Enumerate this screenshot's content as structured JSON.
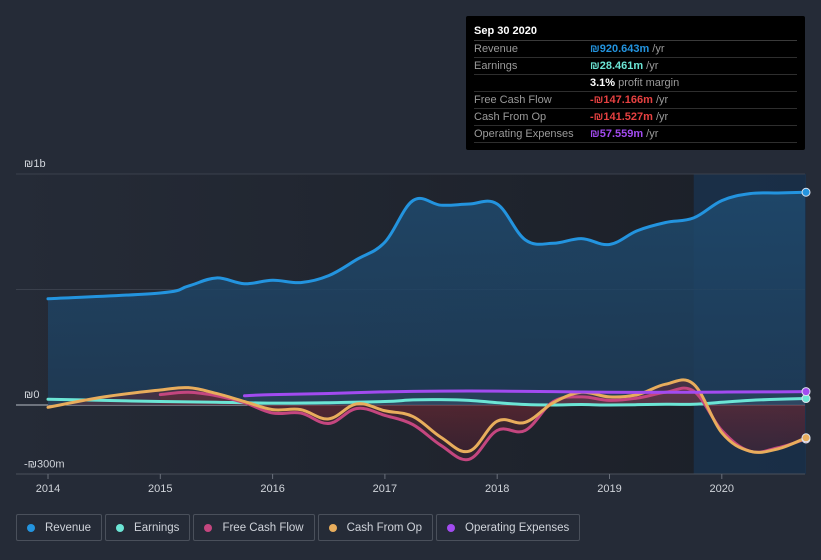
{
  "tooltip": {
    "date": "Sep 30 2020",
    "rows": [
      {
        "label": "Revenue",
        "value": "₪920.643m",
        "unit": "/yr",
        "color": "#2394df"
      },
      {
        "label": "Earnings",
        "value": "₪28.461m",
        "unit": "/yr",
        "color": "#6ce5d5"
      },
      {
        "label": "",
        "value": "3.1%",
        "unit": "profit margin",
        "color": "#ffffff"
      },
      {
        "label": "Free Cash Flow",
        "value": "-₪147.166m",
        "unit": "/yr",
        "color": "#e64141"
      },
      {
        "label": "Cash From Op",
        "value": "-₪141.527m",
        "unit": "/yr",
        "color": "#e64141"
      },
      {
        "label": "Operating Expenses",
        "value": "₪57.559m",
        "unit": "/yr",
        "color": "#a24bf0"
      }
    ]
  },
  "legend": [
    {
      "label": "Revenue",
      "color": "#2394df"
    },
    {
      "label": "Earnings",
      "color": "#6ce5d5"
    },
    {
      "label": "Free Cash Flow",
      "color": "#c4467f"
    },
    {
      "label": "Cash From Op",
      "color": "#e8ad5c"
    },
    {
      "label": "Operating Expenses",
      "color": "#a24bf0"
    }
  ],
  "chart_data": {
    "type": "line",
    "title": "",
    "xlabel": "",
    "ylabel": "",
    "currency": "₪",
    "unit": "m",
    "ylim": [
      -300,
      1000
    ],
    "xlim": [
      2013.7,
      2020.9
    ],
    "y_ticks": [
      {
        "value": 1000,
        "label": "₪1b"
      },
      {
        "value": 0,
        "label": "₪0"
      },
      {
        "value": -300,
        "label": "-₪300m"
      }
    ],
    "x_ticks": [
      {
        "value": 2014,
        "label": "2014"
      },
      {
        "value": 2015,
        "label": "2015"
      },
      {
        "value": 2016,
        "label": "2016"
      },
      {
        "value": 2017,
        "label": "2017"
      },
      {
        "value": 2018,
        "label": "2018"
      },
      {
        "value": 2019,
        "label": "2019"
      },
      {
        "value": 2020,
        "label": "2020"
      }
    ],
    "grid": true,
    "highlight_start": 2019.75,
    "highlight_end": 2020.75,
    "series": [
      {
        "name": "Revenue",
        "color": "#2394df",
        "x": [
          2014.0,
          2015.0,
          2015.25,
          2015.5,
          2015.75,
          2016.0,
          2016.25,
          2016.5,
          2016.75,
          2017.0,
          2017.25,
          2017.5,
          2017.75,
          2018.0,
          2018.25,
          2018.5,
          2018.75,
          2019.0,
          2019.25,
          2019.5,
          2019.75,
          2020.0,
          2020.25,
          2020.5,
          2020.75
        ],
        "values": [
          460,
          485,
          515,
          550,
          525,
          540,
          530,
          560,
          630,
          705,
          885,
          865,
          870,
          870,
          715,
          700,
          720,
          695,
          755,
          790,
          810,
          885,
          915,
          918,
          921
        ]
      },
      {
        "name": "Earnings",
        "color": "#6ce5d5",
        "x": [
          2014.0,
          2014.5,
          2015.0,
          2015.5,
          2016.0,
          2016.5,
          2017.0,
          2017.25,
          2017.5,
          2017.75,
          2018.0,
          2018.25,
          2018.5,
          2018.75,
          2019.0,
          2019.5,
          2019.75,
          2020.0,
          2020.25,
          2020.5,
          2020.75
        ],
        "values": [
          25,
          20,
          15,
          12,
          8,
          10,
          15,
          22,
          23,
          20,
          10,
          2,
          0,
          2,
          0,
          3,
          3,
          12,
          20,
          25,
          28
        ]
      },
      {
        "name": "Free Cash Flow",
        "color": "#c4467f",
        "x": [
          2015.0,
          2015.25,
          2015.5,
          2015.75,
          2016.0,
          2016.25,
          2016.5,
          2016.75,
          2017.0,
          2017.25,
          2017.5,
          2017.75,
          2018.0,
          2018.25,
          2018.5,
          2018.75,
          2019.0,
          2019.25,
          2019.5,
          2019.75,
          2020.0,
          2020.25,
          2020.5,
          2020.75
        ],
        "values": [
          45,
          55,
          40,
          10,
          -35,
          -35,
          -80,
          -15,
          -45,
          -85,
          -175,
          -235,
          -110,
          -110,
          15,
          35,
          20,
          30,
          55,
          60,
          -110,
          -200,
          -185,
          -147
        ]
      },
      {
        "name": "Cash From Op",
        "color": "#e8ad5c",
        "x": [
          2014.0,
          2014.5,
          2015.0,
          2015.25,
          2015.5,
          2015.75,
          2016.0,
          2016.25,
          2016.5,
          2016.75,
          2017.0,
          2017.25,
          2017.5,
          2017.75,
          2018.0,
          2018.25,
          2018.5,
          2018.75,
          2019.0,
          2019.25,
          2019.5,
          2019.75,
          2020.0,
          2020.25,
          2020.5,
          2020.75
        ],
        "values": [
          -10,
          35,
          65,
          75,
          50,
          15,
          -20,
          -20,
          -60,
          5,
          -25,
          -50,
          -140,
          -200,
          -70,
          -75,
          10,
          55,
          35,
          45,
          90,
          90,
          -120,
          -200,
          -190,
          -142
        ]
      },
      {
        "name": "Operating Expenses",
        "color": "#a24bf0",
        "x": [
          2015.75,
          2016.0,
          2016.5,
          2017.0,
          2017.5,
          2018.0,
          2018.5,
          2019.0,
          2019.5,
          2020.0,
          2020.5,
          2020.75
        ],
        "values": [
          40,
          45,
          50,
          57,
          60,
          60,
          58,
          55,
          55,
          56,
          57,
          58
        ]
      }
    ]
  }
}
